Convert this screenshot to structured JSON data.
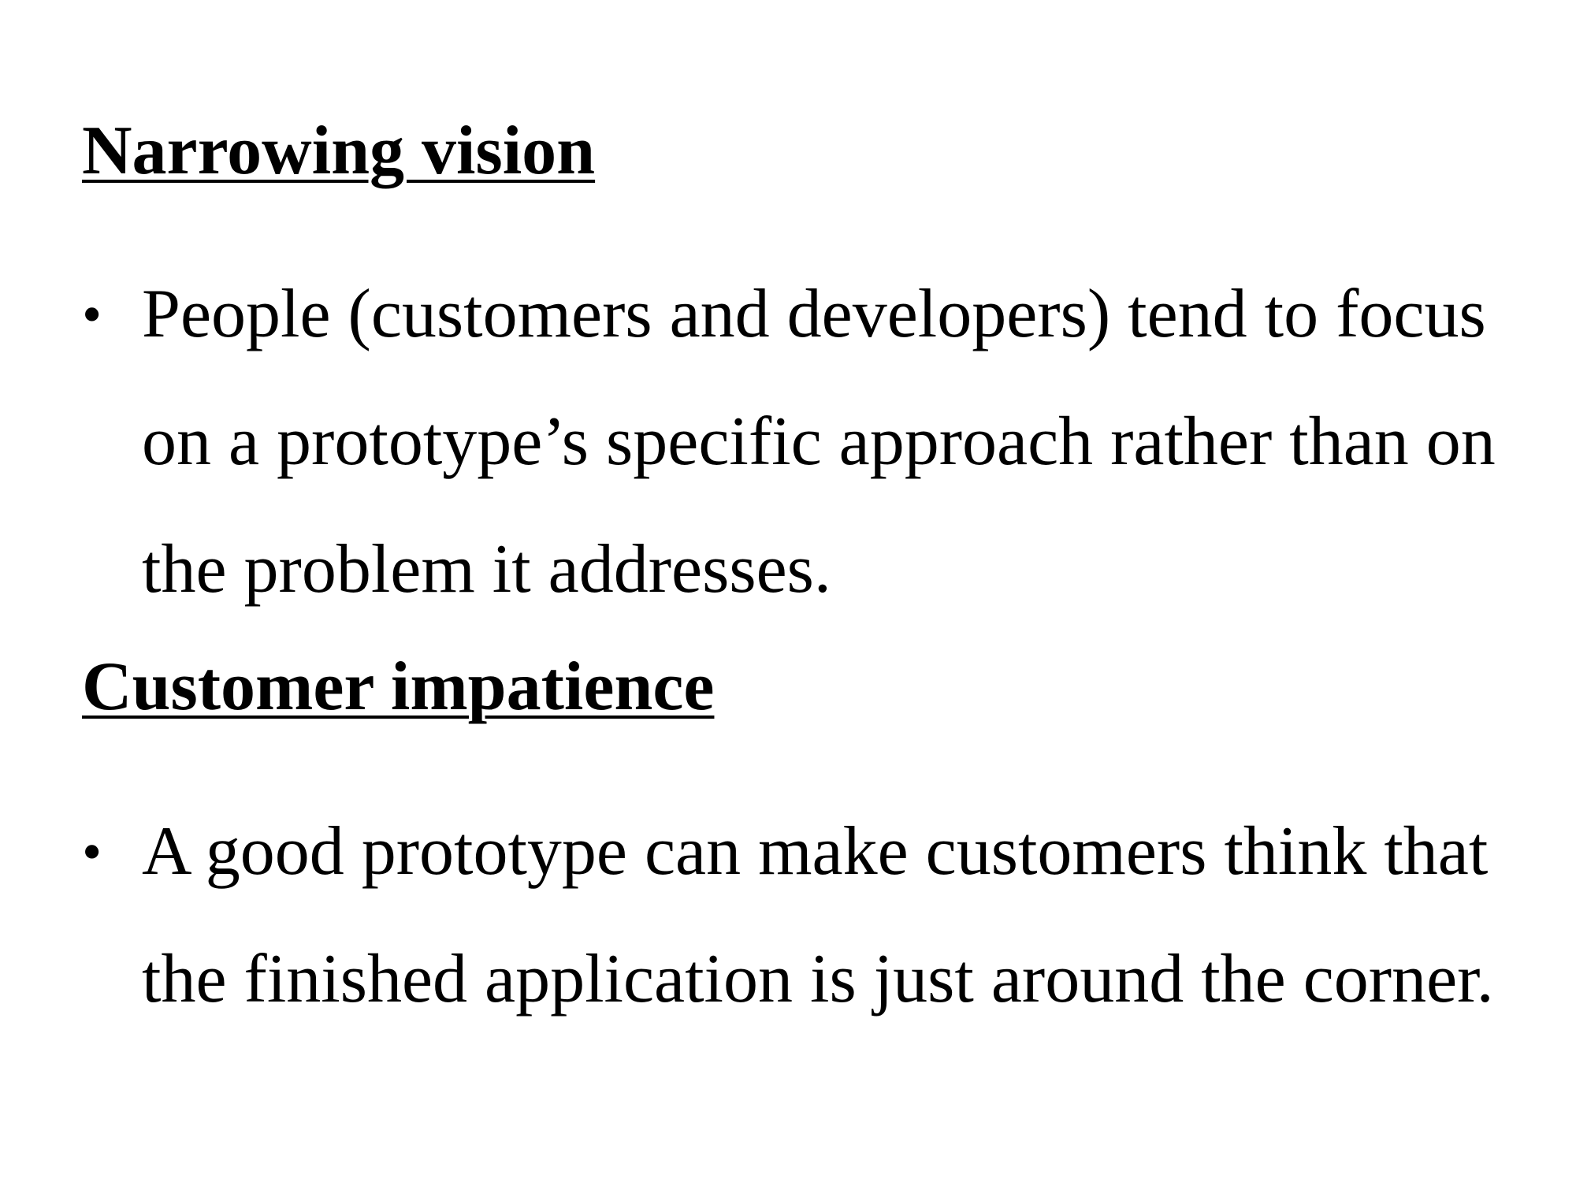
{
  "sections": [
    {
      "heading": "Narrowing vision",
      "bullet_symbol": "•",
      "bullet_lines": [
        "People (customers and developers) tend to focus",
        "on a prototype’s specific approach rather than on",
        "the problem it addresses."
      ]
    },
    {
      "heading": "Customer impatience",
      "bullet_symbol": "•",
      "bullet_lines": [
        "A good prototype can make customers think that",
        "the finished application is just around the corner."
      ]
    }
  ]
}
